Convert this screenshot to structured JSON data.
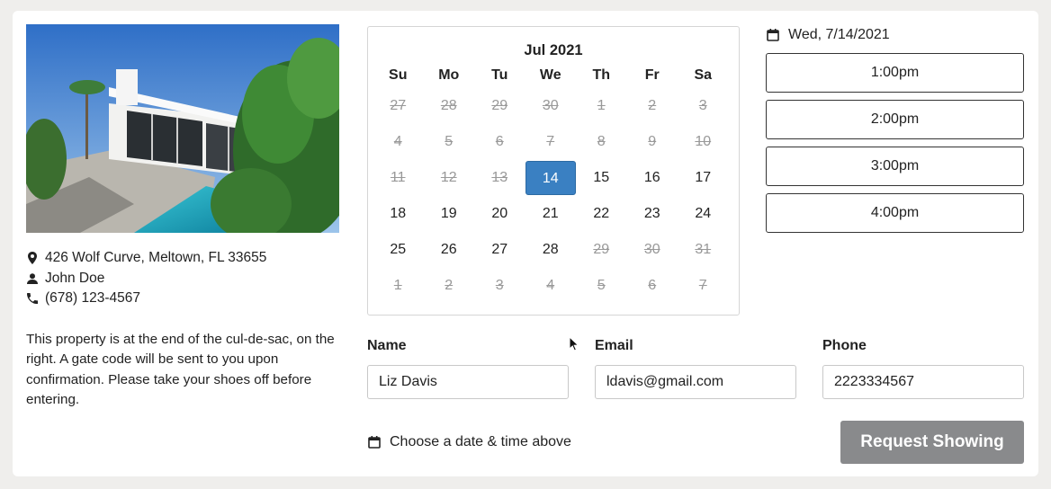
{
  "property": {
    "photo_alt": "Modern white house with pool",
    "address": "426 Wolf Curve, Meltown, FL 33655",
    "agent": "John Doe",
    "phone": "(678) 123-4567",
    "description": "This property is at the end of the cul-de-sac, on the right. A gate code will be sent to you upon confirmation. Please take your shoes off before entering.",
    "icons": {
      "address": "map-pin-icon",
      "agent": "person-icon",
      "phone": "phone-icon"
    }
  },
  "calendar": {
    "title": "Jul 2021",
    "weekdays": [
      "Su",
      "Mo",
      "Tu",
      "We",
      "Th",
      "Fr",
      "Sa"
    ],
    "selected_day": "14",
    "selected_color": "#3a80c2",
    "weeks": [
      [
        {
          "d": "27",
          "off": true
        },
        {
          "d": "28",
          "off": true
        },
        {
          "d": "29",
          "off": true
        },
        {
          "d": "30",
          "off": true
        },
        {
          "d": "1",
          "off": true
        },
        {
          "d": "2",
          "off": true
        },
        {
          "d": "3",
          "off": true
        }
      ],
      [
        {
          "d": "4",
          "off": true
        },
        {
          "d": "5",
          "off": true
        },
        {
          "d": "6",
          "off": true
        },
        {
          "d": "7",
          "off": true
        },
        {
          "d": "8",
          "off": true
        },
        {
          "d": "9",
          "off": true
        },
        {
          "d": "10",
          "off": true
        }
      ],
      [
        {
          "d": "11",
          "off": true
        },
        {
          "d": "12",
          "off": true
        },
        {
          "d": "13",
          "off": true
        },
        {
          "d": "14",
          "off": false,
          "sel": true
        },
        {
          "d": "15",
          "off": false
        },
        {
          "d": "16",
          "off": false
        },
        {
          "d": "17",
          "off": false
        }
      ],
      [
        {
          "d": "18",
          "off": false
        },
        {
          "d": "19",
          "off": false
        },
        {
          "d": "20",
          "off": false
        },
        {
          "d": "21",
          "off": false
        },
        {
          "d": "22",
          "off": false
        },
        {
          "d": "23",
          "off": false
        },
        {
          "d": "24",
          "off": false
        }
      ],
      [
        {
          "d": "25",
          "off": false
        },
        {
          "d": "26",
          "off": false
        },
        {
          "d": "27",
          "off": false
        },
        {
          "d": "28",
          "off": false
        },
        {
          "d": "29",
          "off": true
        },
        {
          "d": "30",
          "off": true
        },
        {
          "d": "31",
          "off": true
        }
      ],
      [
        {
          "d": "1",
          "off": true
        },
        {
          "d": "2",
          "off": true
        },
        {
          "d": "3",
          "off": true
        },
        {
          "d": "4",
          "off": true
        },
        {
          "d": "5",
          "off": true
        },
        {
          "d": "6",
          "off": true
        },
        {
          "d": "7",
          "off": true
        }
      ]
    ]
  },
  "times": {
    "selected_date": "Wed, 7/14/2021",
    "slots": [
      "1:00pm",
      "2:00pm",
      "3:00pm",
      "4:00pm"
    ]
  },
  "form": {
    "name_label": "Name",
    "name_value": "Liz Davis",
    "email_label": "Email",
    "email_value": "ldavis@gmail.com",
    "phone_label": "Phone",
    "phone_value": "2223334567",
    "status_text": "Choose a date & time above",
    "submit_label": "Request Showing",
    "submit_color": "#898a8c"
  }
}
